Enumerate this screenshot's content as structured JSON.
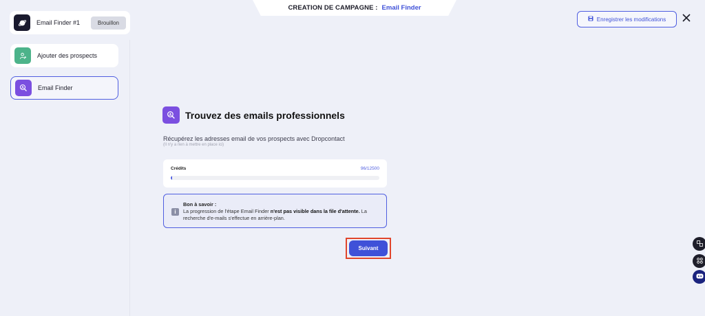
{
  "header": {
    "label": "CREATION DE CAMPAGNE :",
    "campaign_type": "Email Finder"
  },
  "sidebar": {
    "campaign": {
      "name": "Email Finder #1",
      "status": "Brouillon",
      "icon": "planet-icon"
    },
    "steps": [
      {
        "label": "Ajouter des prospects",
        "icon": "user-add-icon",
        "color": "#4cb38a",
        "active": false
      },
      {
        "label": "Email Finder",
        "icon": "search-user-icon",
        "color": "#7b4fe0",
        "active": true
      }
    ]
  },
  "toolbar": {
    "save_label": "Enregistrer les modifications",
    "save_icon": "save-icon",
    "close_icon": "close-icon"
  },
  "main": {
    "title": "Trouvez des emails professionnels",
    "subtitle": "Récupérez les adresses email de vos prospects avec Dropcontact",
    "hint": "(Il n'y a rien à mettre en place ici)",
    "credits": {
      "label": "Crédits",
      "value": "96/12500",
      "used": 96,
      "total": 12500
    },
    "info": {
      "title": "Bon à savoir :",
      "text_before": "La progression de l'étape Email Finder ",
      "text_bold": "n'est pas visible dans la file d'attente.",
      "text_after": " La recherche d'e-mails s'effectue en arrière-plan."
    },
    "next_label": "Suivant"
  },
  "colors": {
    "accent": "#3f51d8",
    "background": "#eef0f8",
    "highlight": "#e0452b"
  }
}
